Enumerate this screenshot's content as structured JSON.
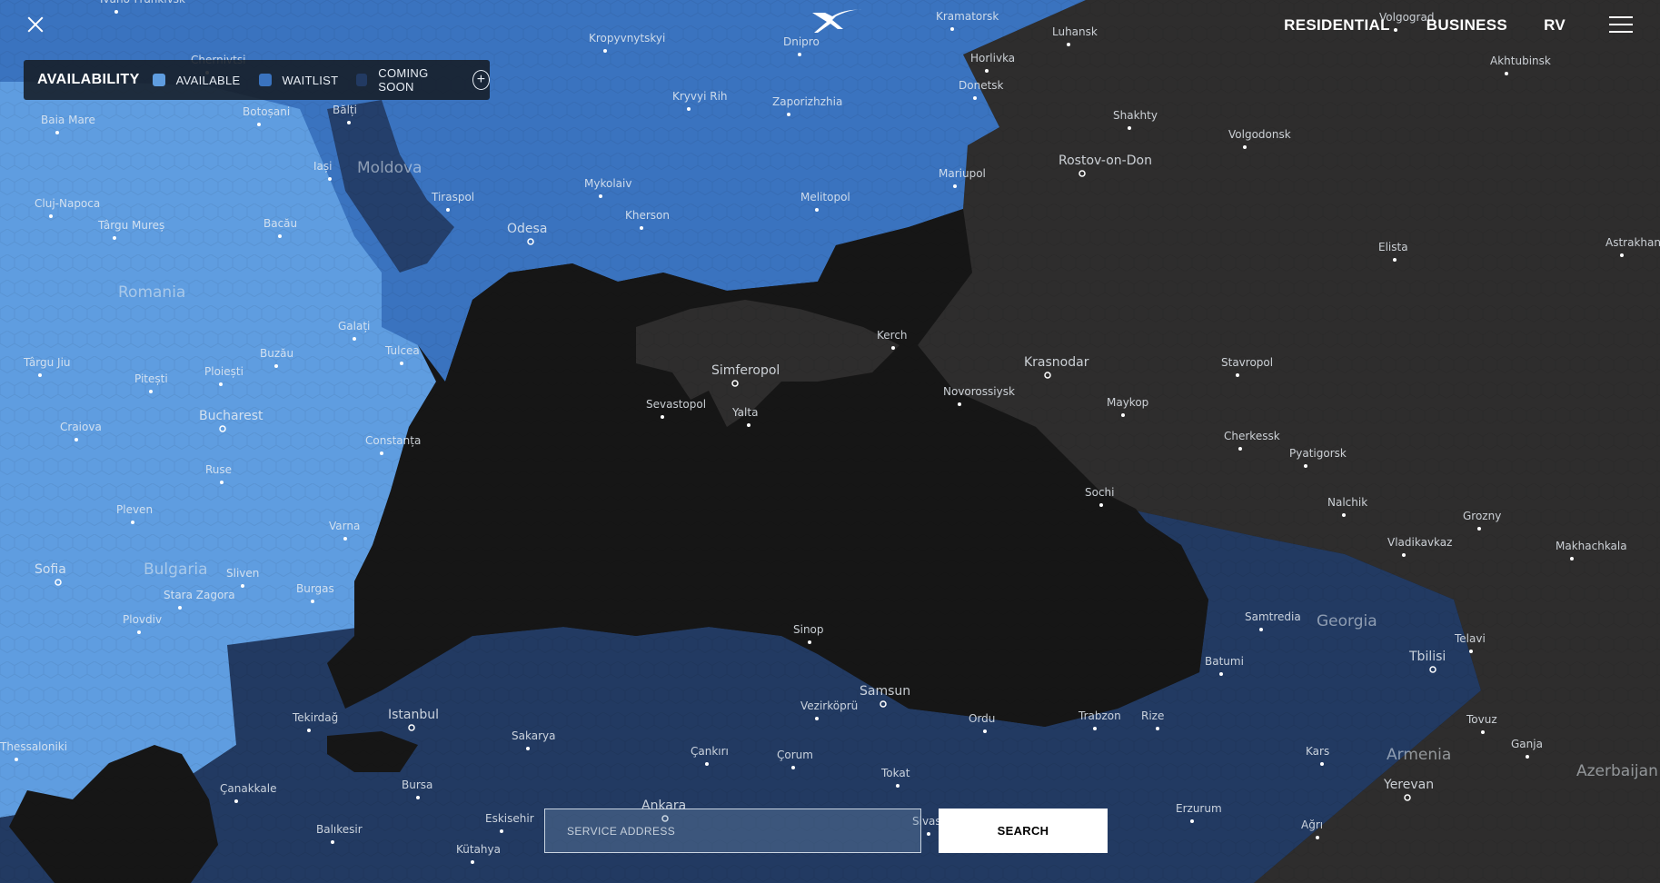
{
  "header": {
    "close_icon": "close-icon",
    "logo_icon": "x-logo-icon",
    "nav": [
      "RESIDENTIAL",
      "BUSINESS",
      "RV"
    ],
    "menu_icon": "hamburger-menu-icon"
  },
  "legend": {
    "title": "AVAILABILITY",
    "items": [
      {
        "label": "AVAILABLE",
        "color": "#5f9de0"
      },
      {
        "label": "WAITLIST",
        "color": "#3a73bf"
      },
      {
        "label": "COMING SOON",
        "color": "#223a62"
      }
    ],
    "expand_icon": "plus-circle-icon"
  },
  "map": {
    "colors": {
      "sea": "#161616",
      "land_dark": "#2e2d2d",
      "available": "#5f9de0",
      "waitlist": "#3a73bf",
      "coming_soon": "#223a62"
    },
    "regions": [
      "Romania",
      "Moldova",
      "Bulgaria",
      "Georgia",
      "Armenia",
      "Azerbaijan"
    ],
    "cities": [
      "Ivano-Frankivsk",
      "Chernivtsi",
      "Kropyvnytskyi",
      "Dnipro",
      "Kramatorsk",
      "Luhansk",
      "Volgograd",
      "Akhtubinsk",
      "Baia Mare",
      "Botoșani",
      "Bălți",
      "Horlivka",
      "Donetsk",
      "Kryvyi Rih",
      "Zaporizhzhia",
      "Shakhty",
      "Volgodonsk",
      "Iași",
      "Cluj-Napoca",
      "Tiraspol",
      "Mykolaiv",
      "Melitopol",
      "Mariupol",
      "Rostov-on-Don",
      "Târgu Mureș",
      "Bacău",
      "Kherson",
      "Odesa",
      "Elista",
      "Astrakhan",
      "Galați",
      "Tulcea",
      "Kerch",
      "Buzău",
      "Simferopol",
      "Krasnodar",
      "Stavropol",
      "Târgu Jiu",
      "Pitești",
      "Ploiești",
      "Sevastopol",
      "Novorossiysk",
      "Yalta",
      "Maykop",
      "Bucharest",
      "Craiova",
      "Constanța",
      "Cherkessk",
      "Pyatigorsk",
      "Ruse",
      "Sochi",
      "Nalchik",
      "Grozny",
      "Pleven",
      "Varna",
      "Vladikavkaz",
      "Makhachkala",
      "Sofia",
      "Sliven",
      "Stara Zagora",
      "Burgas",
      "Plovdiv",
      "Samtredia",
      "Sinop",
      "Batumi",
      "Telavi",
      "Tbilisi",
      "Samsun",
      "Vezirköprü",
      "Ordu",
      "Trabzon",
      "Rize",
      "Tekirdağ",
      "Istanbul",
      "Sakarya",
      "Çankırı",
      "Çorum",
      "Kars",
      "Tovuz",
      "Ganja",
      "Thessaloniki",
      "Tokat",
      "Yerevan",
      "Çanakkale",
      "Bursa",
      "Ankara",
      "Eskisehir",
      "Sivas",
      "Erzurum",
      "Ağrı",
      "Balıkesir",
      "Kütahya"
    ]
  },
  "search": {
    "placeholder": "SERVICE ADDRESS",
    "button": "SEARCH"
  }
}
